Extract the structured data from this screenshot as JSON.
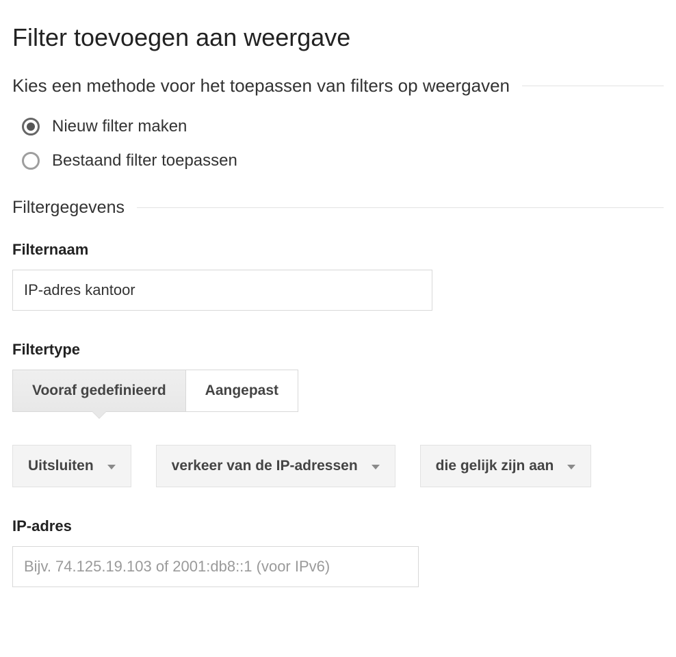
{
  "page": {
    "title": "Filter toevoegen aan weergave"
  },
  "method_section": {
    "heading": "Kies een methode voor het toepassen van filters op weergaven",
    "options": [
      {
        "label": "Nieuw filter maken",
        "selected": true
      },
      {
        "label": "Bestaand filter toepassen",
        "selected": false
      }
    ]
  },
  "filter_data_section": {
    "heading": "Filtergegevens",
    "filter_name": {
      "label": "Filternaam",
      "value": "IP-adres kantoor"
    },
    "filter_type": {
      "label": "Filtertype",
      "tabs": [
        {
          "label": "Vooraf gedefinieerd",
          "active": true
        },
        {
          "label": "Aangepast",
          "active": false
        }
      ],
      "selects": [
        {
          "label": "Uitsluiten"
        },
        {
          "label": "verkeer van de IP-adressen"
        },
        {
          "label": "die gelijk zijn aan"
        }
      ]
    },
    "ip_address": {
      "label": "IP-adres",
      "placeholder": "Bijv. 74.125.19.103 of 2001:db8::1 (voor IPv6)",
      "value": ""
    }
  }
}
